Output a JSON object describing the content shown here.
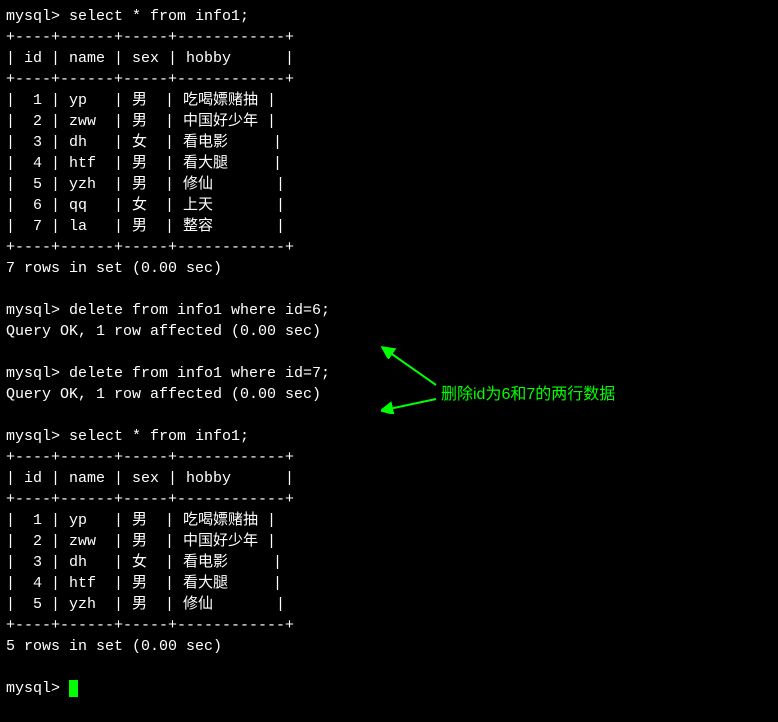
{
  "query1": {
    "prompt": "mysql> ",
    "command": "select * from info1;",
    "border": "+----+------+-----+------------+",
    "header": "| id | name | sex | hobby      |",
    "rows": [
      "|  1 | yp   | 男  | 吃喝嫖赌抽 |",
      "|  2 | zww  | 男  | 中国好少年 |",
      "|  3 | dh   | 女  | 看电影     |",
      "|  4 | htf  | 男  | 看大腿     |",
      "|  5 | yzh  | 男  | 修仙       |",
      "|  6 | qq   | 女  | 上天       |",
      "|  7 | la   | 男  | 整容       |"
    ],
    "footer": "7 rows in set (0.00 sec)"
  },
  "delete1": {
    "prompt": "mysql> ",
    "command": "delete from info1 where id=6;",
    "result": "Query OK, 1 row affected (0.00 sec)"
  },
  "delete2": {
    "prompt": "mysql> ",
    "command": "delete from info1 where id=7;",
    "result": "Query OK, 1 row affected (0.00 sec)"
  },
  "query2": {
    "prompt": "mysql> ",
    "command": "select * from info1;",
    "border": "+----+------+-----+------------+",
    "header": "| id | name | sex | hobby      |",
    "rows": [
      "|  1 | yp   | 男  | 吃喝嫖赌抽 |",
      "|  2 | zww  | 男  | 中国好少年 |",
      "|  3 | dh   | 女  | 看电影     |",
      "|  4 | htf  | 男  | 看大腿     |",
      "|  5 | yzh  | 男  | 修仙       |"
    ],
    "footer": "5 rows in set (0.00 sec)"
  },
  "final_prompt": "mysql> ",
  "annotation": {
    "text": "删除id为6和7的两行数据"
  },
  "chart_data": {
    "type": "table",
    "description": "MySQL terminal session showing SELECT and DELETE operations on table info1",
    "table_before": {
      "columns": [
        "id",
        "name",
        "sex",
        "hobby"
      ],
      "rows": [
        [
          1,
          "yp",
          "男",
          "吃喝嫖赌抽"
        ],
        [
          2,
          "zww",
          "男",
          "中国好少年"
        ],
        [
          3,
          "dh",
          "女",
          "看电影"
        ],
        [
          4,
          "htf",
          "男",
          "看大腿"
        ],
        [
          5,
          "yzh",
          "男",
          "修仙"
        ],
        [
          6,
          "qq",
          "女",
          "上天"
        ],
        [
          7,
          "la",
          "男",
          "整容"
        ]
      ],
      "row_count": 7,
      "timing": "0.00 sec"
    },
    "operations": [
      {
        "sql": "delete from info1 where id=6;",
        "rows_affected": 1,
        "timing": "0.00 sec"
      },
      {
        "sql": "delete from info1 where id=7;",
        "rows_affected": 1,
        "timing": "0.00 sec"
      }
    ],
    "table_after": {
      "columns": [
        "id",
        "name",
        "sex",
        "hobby"
      ],
      "rows": [
        [
          1,
          "yp",
          "男",
          "吃喝嫖赌抽"
        ],
        [
          2,
          "zww",
          "男",
          "中国好少年"
        ],
        [
          3,
          "dh",
          "女",
          "看电影"
        ],
        [
          4,
          "htf",
          "男",
          "看大腿"
        ],
        [
          5,
          "yzh",
          "男",
          "修仙"
        ]
      ],
      "row_count": 5,
      "timing": "0.00 sec"
    },
    "annotation_text": "删除id为6和7的两行数据"
  }
}
